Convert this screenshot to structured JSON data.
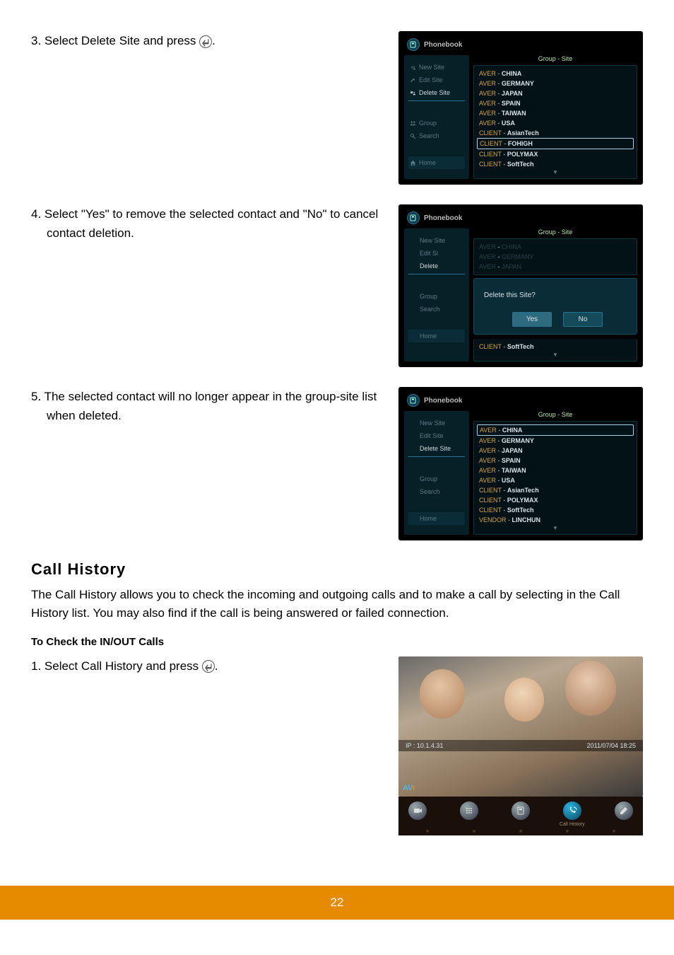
{
  "step3": {
    "text_prefix": "3. Select Delete Site and press ",
    "text_suffix": "."
  },
  "step4": {
    "text": "4. Select \"Yes\" to remove the selected contact and \"No\" to cancel contact deletion."
  },
  "step5": {
    "text": "5. The selected contact will no longer appear in the group-site list when deleted."
  },
  "phonebook": {
    "title": "Phonebook",
    "group_site_header": "Group - Site",
    "menu": {
      "new_site": "New Site",
      "edit_site": "Edit Site",
      "delete_site": "Delete Site",
      "group": "Group",
      "search": "Search",
      "home": "Home",
      "edit_site_short": "Edit Si",
      "delete_short": "Delete",
      "group_short": "Group",
      "search_short": "Search"
    }
  },
  "sites_a": [
    {
      "g": "AVER",
      "s": "CHINA",
      "sel": false
    },
    {
      "g": "AVER",
      "s": "GERMANY",
      "sel": false
    },
    {
      "g": "AVER",
      "s": "JAPAN",
      "sel": false
    },
    {
      "g": "AVER",
      "s": "SPAIN",
      "sel": false
    },
    {
      "g": "AVER",
      "s": "TAIWAN",
      "sel": false
    },
    {
      "g": "AVER",
      "s": "USA",
      "sel": false
    },
    {
      "g": "CLIENT",
      "s": "AsianTech",
      "sel": false
    },
    {
      "g": "CLIENT",
      "s": "FOHIGH",
      "sel": true
    },
    {
      "g": "CLIENT",
      "s": "POLYMAX",
      "sel": false
    },
    {
      "g": "CLIENT",
      "s": "SoftTech",
      "sel": false
    }
  ],
  "dialog": {
    "question": "Delete this Site?",
    "yes": "Yes",
    "no": "No",
    "bottom_g": "CLIENT",
    "bottom_s": "SoftTech",
    "sites_dim": [
      {
        "g": "AVER",
        "s": "CHINA"
      },
      {
        "g": "AVER",
        "s": "GERMANY"
      },
      {
        "g": "AVER",
        "s": "JAPAN"
      }
    ]
  },
  "sites_c": [
    {
      "g": "AVER",
      "s": "CHINA",
      "sel": true
    },
    {
      "g": "AVER",
      "s": "GERMANY",
      "sel": false
    },
    {
      "g": "AVER",
      "s": "JAPAN",
      "sel": false
    },
    {
      "g": "AVER",
      "s": "SPAIN",
      "sel": false
    },
    {
      "g": "AVER",
      "s": "TAIWAN",
      "sel": false
    },
    {
      "g": "AVER",
      "s": "USA",
      "sel": false
    },
    {
      "g": "CLIENT",
      "s": "AsianTech",
      "sel": false
    },
    {
      "g": "CLIENT",
      "s": "POLYMAX",
      "sel": false
    },
    {
      "g": "CLIENT",
      "s": "SoftTech",
      "sel": false
    },
    {
      "g": "VENDOR",
      "s": "LINCHUN",
      "sel": false
    }
  ],
  "call_history": {
    "heading": "Call History",
    "para": "The Call History allows you to check the incoming and outgoing calls and to make a call by selecting in the Call History list. You may also find if the call is being answered or failed connection.",
    "sub": "To Check the IN/OUT Calls",
    "step1_prefix": "1. Select Call History and press ",
    "step1_suffix": "."
  },
  "home_shot": {
    "ip": "IP : 10.1.4.31",
    "time": "2011/07/04 18:25",
    "label": "Call History",
    "brand_left": "AV",
    "brand_right": "r"
  },
  "page_number": "22"
}
